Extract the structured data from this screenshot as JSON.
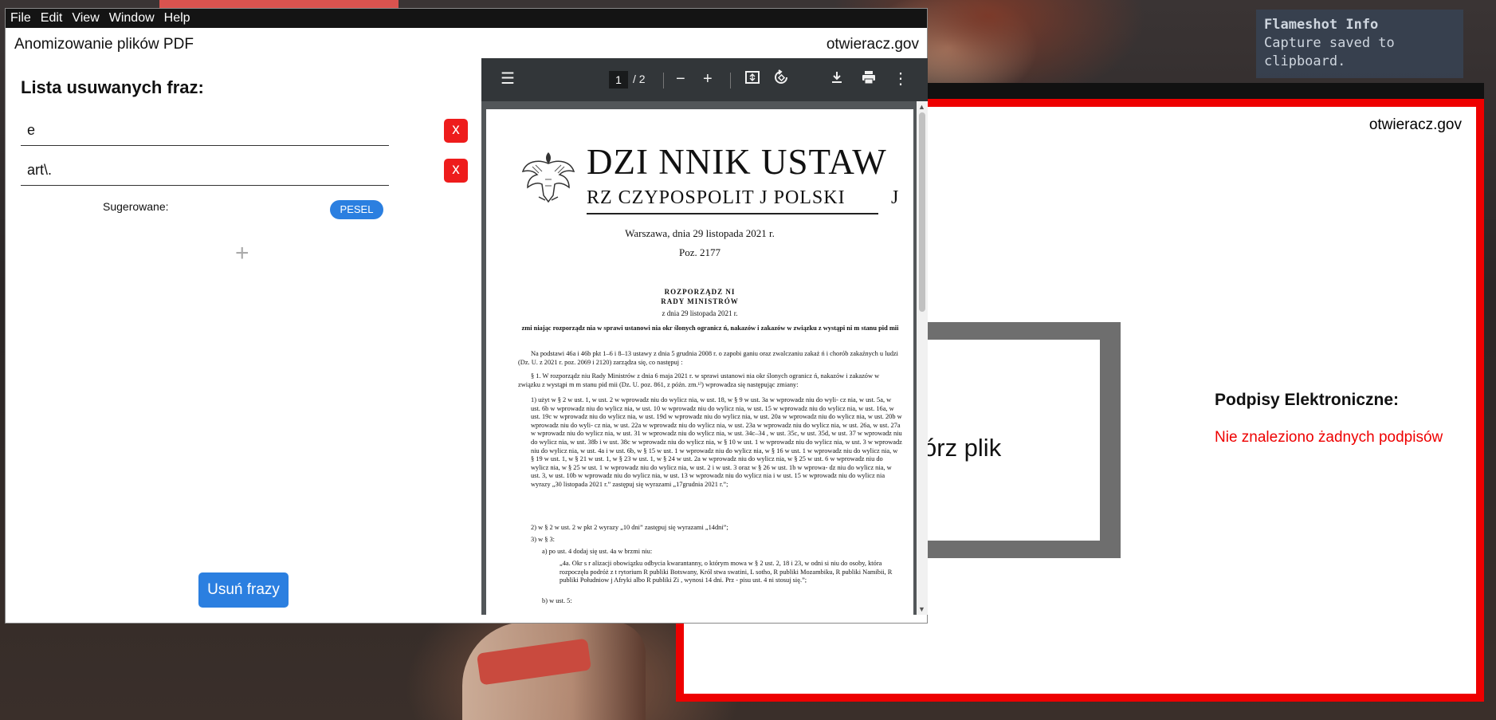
{
  "menu": [
    "File",
    "Edit",
    "View",
    "Window",
    "Help"
  ],
  "app": {
    "title": "Anomizowanie plików PDF",
    "brand": "otwieracz.gov"
  },
  "phrases": {
    "title": "Lista usuwanych fraz:",
    "items": [
      {
        "value": "e",
        "delete_label": "x"
      },
      {
        "value": "art\\.",
        "delete_label": "x"
      }
    ],
    "suggested_label": "Sugerowane:",
    "suggested_chips": [
      "PESEL"
    ],
    "add_label": "+",
    "remove_button": "Usuń frazy"
  },
  "pdf": {
    "page_current": "1",
    "page_total": "/  2",
    "title_line1": "DZI    NNIK USTAW",
    "title_line2": "RZ   CZYPOSPOLIT      J POLSKI",
    "title_line2_end": "J",
    "date": "Warszawa, dnia 29 listopada 2021 r.",
    "poz": "Poz. 2177",
    "roz1": "ROZPORZĄDZ     NI",
    "roz2": "RADY MINISTRÓW",
    "roz_date": "z dnia 29 listopada 2021 r.",
    "heading": "zmi    niając    rozporządz    nia w sprawi    ustanowi    nia okr    ślonych ogranicz    ń, nakazów i zakazów w związku z wystąpi    ni    m stanu    pid    mii",
    "para1": "Na podstawi        46a i       46b pkt 1–6 i 8–13 ustawy z dnia 5 grudnia 2008 r. o zapobi       ganiu oraz zwalczaniu zakaż    ń i chorób zakaźnych u ludzi (Dz. U. z 2021 r. poz. 2069 i 2120) zarządza się, co następuj    :",
    "para2": "§ 1. W rozporządz    niu Rady Ministrów z dnia 6 maja 2021 r. w sprawi    ustanowi    nia okr    ślonych ogranicz    ń, nakazów i zakazów w związku z wystąpi      m    m stanu    pid    mii (Dz. U. poz. 861, z późn. zm.¹⁾) wprowadza się następując    zmiany:",
    "item1": "1)    użyt    w § 2 w ust. 1, w ust. 2 w      wprowadz      niu do wylicz    nia, w ust. 18, w § 9 w ust. 3a w      wprowadz      niu do wyli- cz      nia, w ust. 5a, w ust. 6b w      wprowadz      niu do wylicz      nia, w ust. 10 w      wprowadz   niu do wylicz      nia, w ust. 15 w      wprowadz   niu do wylicz      nia, w ust. 16a, w ust. 19c w        wprowadz   niu  do  wylicz   nia, w ust. 19d w  wprowadz   niu do wylicz   nia, w ust. 20a w  wprowadz   niu do wylicz   nia, w ust. 20b w   wprowadz   niu do wyli- cz  nia, w ust. 22a w      wprowadz      niu do wylicz      nia, w ust. 23a w      wprowadz      niu do wylicz      nia, w ust. 26a, w ust. 27a w      wprowadz   niu do wylicz   nia, w ust. 31  w   wprowadz      niu do wylicz      nia, w ust. 34c–34  , w ust. 35c, w ust. 35d, w ust. 37 w      wprowadz      niu do wylicz      nia, w ust. 38b i w ust. 38c w  wprowadz   niu do wylicz   nia, w § 10 w ust. 1 w      wprowadz   niu do wylicz   nia, w ust. 3 w      wprowadz   niu do wylicz   nia, w ust. 4a i w ust. 6b, w § 15 w ust. 1 w      wprowadz      niu do wylicz   nia, w § 16 w ust. 1 w      wprowadz      niu do wylicz   nia, w § 19 w ust. 1, w § 21  w ust. 1,  w § 23  w ust. 1,  w § 24  w ust. 2a  w      wprowadz   niu do wylicz      nia, w § 25 w ust. 6 w      wprowadz      niu do wylicz   nia, w § 25 w ust. 1 w      wprowadz      niu do wylicz      nia, w ust. 2 i w ust. 3 oraz w § 26 w ust. 1b w    wprowa- dz   niu do wylicz   nia, w ust. 3, w ust. 10b w      wprowadz      niu do wylicz      nia, w ust. 13 w      wprowadz      niu do wylicz   nia i w ust. 15 w  wprowadz   niu do wylicz   nia wyrazy „30 listopada 2021 r.” zastępuj    się wyrazami „17grudnia 2021 r.”;",
    "item2": "2)    w § 2 w ust. 2 w pkt 2 wyrazy „10 dni” zastępuj    się wyrazami „14dni”;",
    "item3": "3)    w § 3:",
    "item3a": "a)    po ust. 4 dodaj      się ust. 4a w brzmi      niu:",
    "quote": "„4a. Okr    s  r      alizacji obowiązku odbycia kwarantanny, o którym mowa w § 2 ust. 2, 18 i 23, w odni      si   niu do osoby, która rozpoczęła podróż z t   rytorium R      publiki Botswany, Król      stwa    swatini, L      sotho, R   publiki Mozambiku, R      publiki Namibii, R   publiki Południow      j Afryki albo R      publiki Zi      , wynosi 14 dni. Prz    - pisu ust. 4 ni      stosuj    się.”;",
    "item3b": "b)    w ust. 5:"
  },
  "second_window": {
    "brand": "otwieracz.gov",
    "drop_text": "órz plik",
    "signatures_title": "Podpisy Elektroniczne:",
    "signatures_none": "Nie znaleziono żadnych podpisów"
  },
  "notification": {
    "title": "Flameshot Info",
    "message": "Capture saved to clipboard."
  },
  "colors": {
    "accent_blue": "#2b7fe0",
    "delete_red": "#ee1c1c",
    "frame_red": "#ee0000",
    "menubar": "#141414",
    "pdf_toolbar": "#323639"
  }
}
